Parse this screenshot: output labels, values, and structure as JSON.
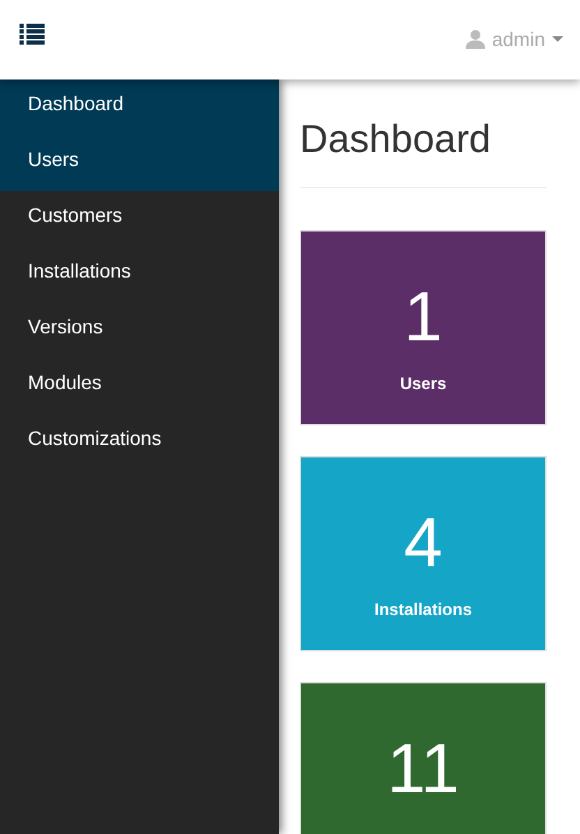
{
  "header": {
    "user": "admin"
  },
  "sidebar": {
    "items": [
      {
        "label": "Dashboard",
        "selected": true
      },
      {
        "label": "Users",
        "selected": true
      },
      {
        "label": "Customers",
        "selected": false
      },
      {
        "label": "Installations",
        "selected": false
      },
      {
        "label": "Versions",
        "selected": false
      },
      {
        "label": "Modules",
        "selected": false
      },
      {
        "label": "Customizations",
        "selected": false
      }
    ]
  },
  "page": {
    "title": "Dashboard"
  },
  "cards": [
    {
      "count": "1",
      "label": "Users",
      "color": "#5c2e67"
    },
    {
      "count": "4",
      "label": "Installations",
      "color": "#14a5c7"
    },
    {
      "count": "11",
      "color": "#2f6930"
    }
  ]
}
